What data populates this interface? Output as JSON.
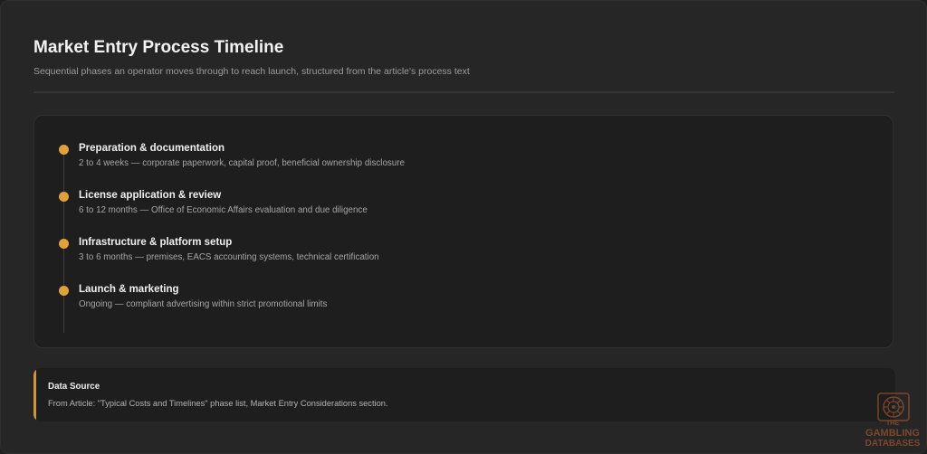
{
  "header": {
    "title": "Market Entry Process Timeline",
    "subtitle": "Sequential phases an operator moves through to reach launch, structured from the article's process text"
  },
  "timeline": {
    "accent_color": "#e0a03c",
    "steps": [
      {
        "title": "Preparation & documentation",
        "description": "2 to 4 weeks — corporate paperwork, capital proof, beneficial ownership disclosure"
      },
      {
        "title": "License application & review",
        "description": "6 to 12 months — Office of Economic Affairs evaluation and due diligence"
      },
      {
        "title": "Infrastructure & platform setup",
        "description": "3 to 6 months — premises, EACS accounting systems, technical certification"
      },
      {
        "title": "Launch & marketing",
        "description": "Ongoing — compliant advertising within strict promotional limits"
      }
    ]
  },
  "source": {
    "heading": "Data Source",
    "text": "From Article: \"Typical Costs and Timelines\" phase list, Market Entry Considerations section."
  },
  "watermark": {
    "icon": "roulette-wheel-icon",
    "line1": "THE",
    "line2": "GAMBLING",
    "line3": "DATABASES"
  }
}
